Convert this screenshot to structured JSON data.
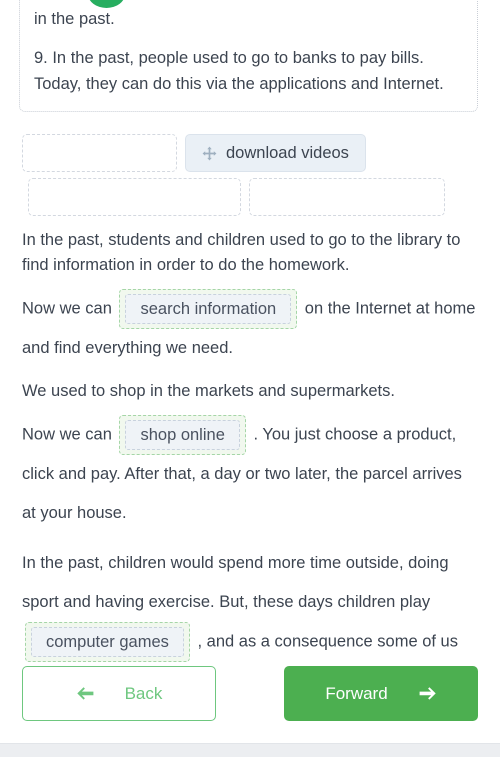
{
  "badge": {
    "name": "progress-badge",
    "color": "#27ae60"
  },
  "question_box": {
    "lines": [
      "in the past.",
      "9. In the past, people used to go to banks to pay bills. Today, they can do this via the applications and Internet."
    ]
  },
  "answer_bank": {
    "chips": [
      {
        "label": "download videos",
        "icon": "move-icon"
      }
    ],
    "empty_slots": 3
  },
  "body": {
    "p1": {
      "text": "In the past, students and children used to go to the library to find information in order to do the homework."
    },
    "p2": {
      "before": "Now we can",
      "answer": "search information",
      "after": "on the Internet at home and find everything we need."
    },
    "p3": {
      "text": "We used to shop in the markets and supermarkets."
    },
    "p4": {
      "before": "Now we can",
      "answer": "shop online",
      "after": ". You just choose a product, click and pay. After that, a day or two later, the parcel arrives at your house."
    },
    "p5": {
      "before": "In the past, children would spend more time outside, doing sport and having exercise. But, these days children play",
      "answer": "computer games",
      "after": ", and as a consequence some of us aren’t fit and healthy."
    }
  },
  "nav": {
    "back_label": "Back",
    "forward_label": "Forward",
    "back_color": "#6ec77f",
    "forward_color": "#4caf50"
  }
}
